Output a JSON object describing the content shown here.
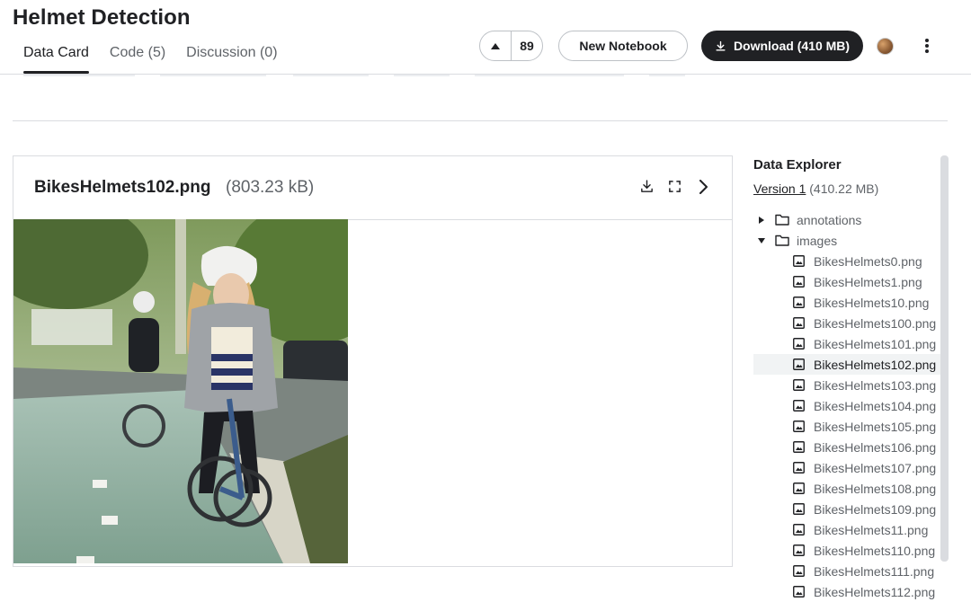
{
  "page": {
    "title": "Helmet Detection"
  },
  "tabs": [
    {
      "label": "Data Card"
    },
    {
      "label": "Code (5)"
    },
    {
      "label": "Discussion (0)"
    }
  ],
  "actions": {
    "vote_count": "89",
    "new_notebook": "New Notebook",
    "download": "Download (410 MB)"
  },
  "preview": {
    "filename": "BikesHelmets102.png",
    "filesize": "(803.23 kB)"
  },
  "explorer": {
    "title": "Data Explorer",
    "version_link": "Version 1",
    "version_size": "(410.22 MB)",
    "folders": [
      {
        "name": "annotations",
        "expanded": false
      },
      {
        "name": "images",
        "expanded": true
      }
    ],
    "files": [
      "BikesHelmets0.png",
      "BikesHelmets1.png",
      "BikesHelmets10.png",
      "BikesHelmets100.png",
      "BikesHelmets101.png",
      "BikesHelmets102.png",
      "BikesHelmets103.png",
      "BikesHelmets104.png",
      "BikesHelmets105.png",
      "BikesHelmets106.png",
      "BikesHelmets107.png",
      "BikesHelmets108.png",
      "BikesHelmets109.png",
      "BikesHelmets11.png",
      "BikesHelmets110.png",
      "BikesHelmets111.png",
      "BikesHelmets112.png"
    ],
    "selected_file": "BikesHelmets102.png"
  },
  "colors": {
    "primary_dark": "#202124",
    "border": "#dadce0",
    "muted_text": "#5f6368",
    "selected_row": "#f1f3f4"
  },
  "icons": [
    "arrow-up-icon",
    "download-icon",
    "fullscreen-icon",
    "chevron-right-icon",
    "more-vert-icon",
    "folder-icon",
    "image-file-icon",
    "caret-right-icon",
    "caret-down-icon"
  ]
}
